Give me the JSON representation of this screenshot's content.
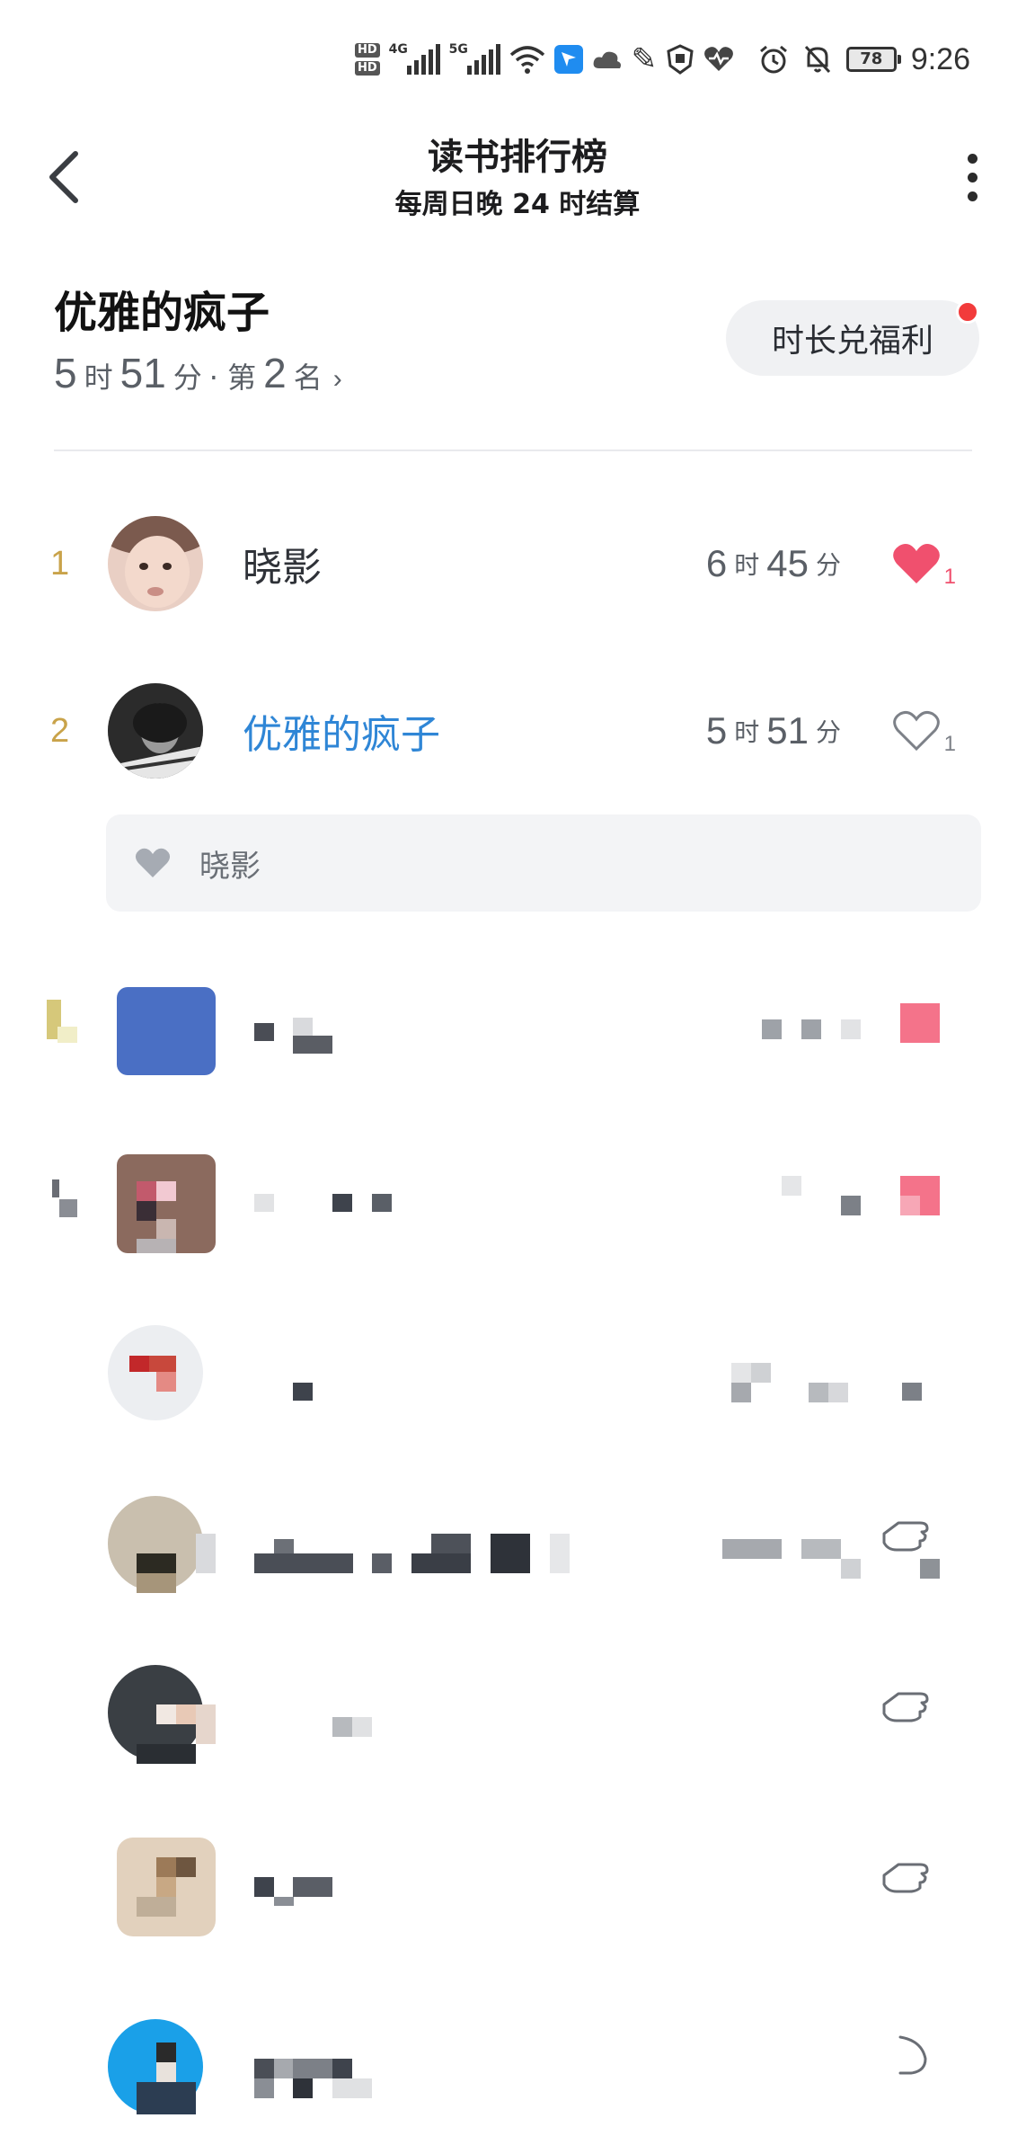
{
  "status_bar": {
    "hd_1": "HD",
    "hd_2": "HD",
    "net_1": "4G",
    "net_2": "5G",
    "battery": "78",
    "time": "9:26",
    "icons": [
      "wifi-icon",
      "app-icon",
      "cloud-icon",
      "ime-icon",
      "shield-icon",
      "heart-icon",
      "alarm-icon",
      "bell-off-icon"
    ]
  },
  "header": {
    "title": "读书排行榜",
    "subtitle": "每周日晚 24 时结算"
  },
  "me": {
    "name": "优雅的疯子",
    "hours": "5",
    "hour_unit": "时",
    "minutes": "51",
    "minute_unit": "分",
    "rank_prefix": "· 第",
    "rank": "2",
    "rank_suffix": "名",
    "reward_button": "时长兑福利"
  },
  "ranking": [
    {
      "rank": "1",
      "name": "晓影",
      "hours": "6",
      "hour_unit": "时",
      "minutes": "45",
      "minute_unit": "分",
      "liked": true,
      "likes": "1"
    },
    {
      "rank": "2",
      "name": "优雅的疯子",
      "hours": "5",
      "hour_unit": "时",
      "minutes": "51",
      "minute_unit": "分",
      "liked": false,
      "likes": "1"
    }
  ],
  "likers": {
    "name": "晓影"
  },
  "colors": {
    "accent_blue": "#2f86d6",
    "like_red": "#f0506e",
    "rank_gold": "#c9a34a",
    "badge_red": "#f23b3b"
  }
}
